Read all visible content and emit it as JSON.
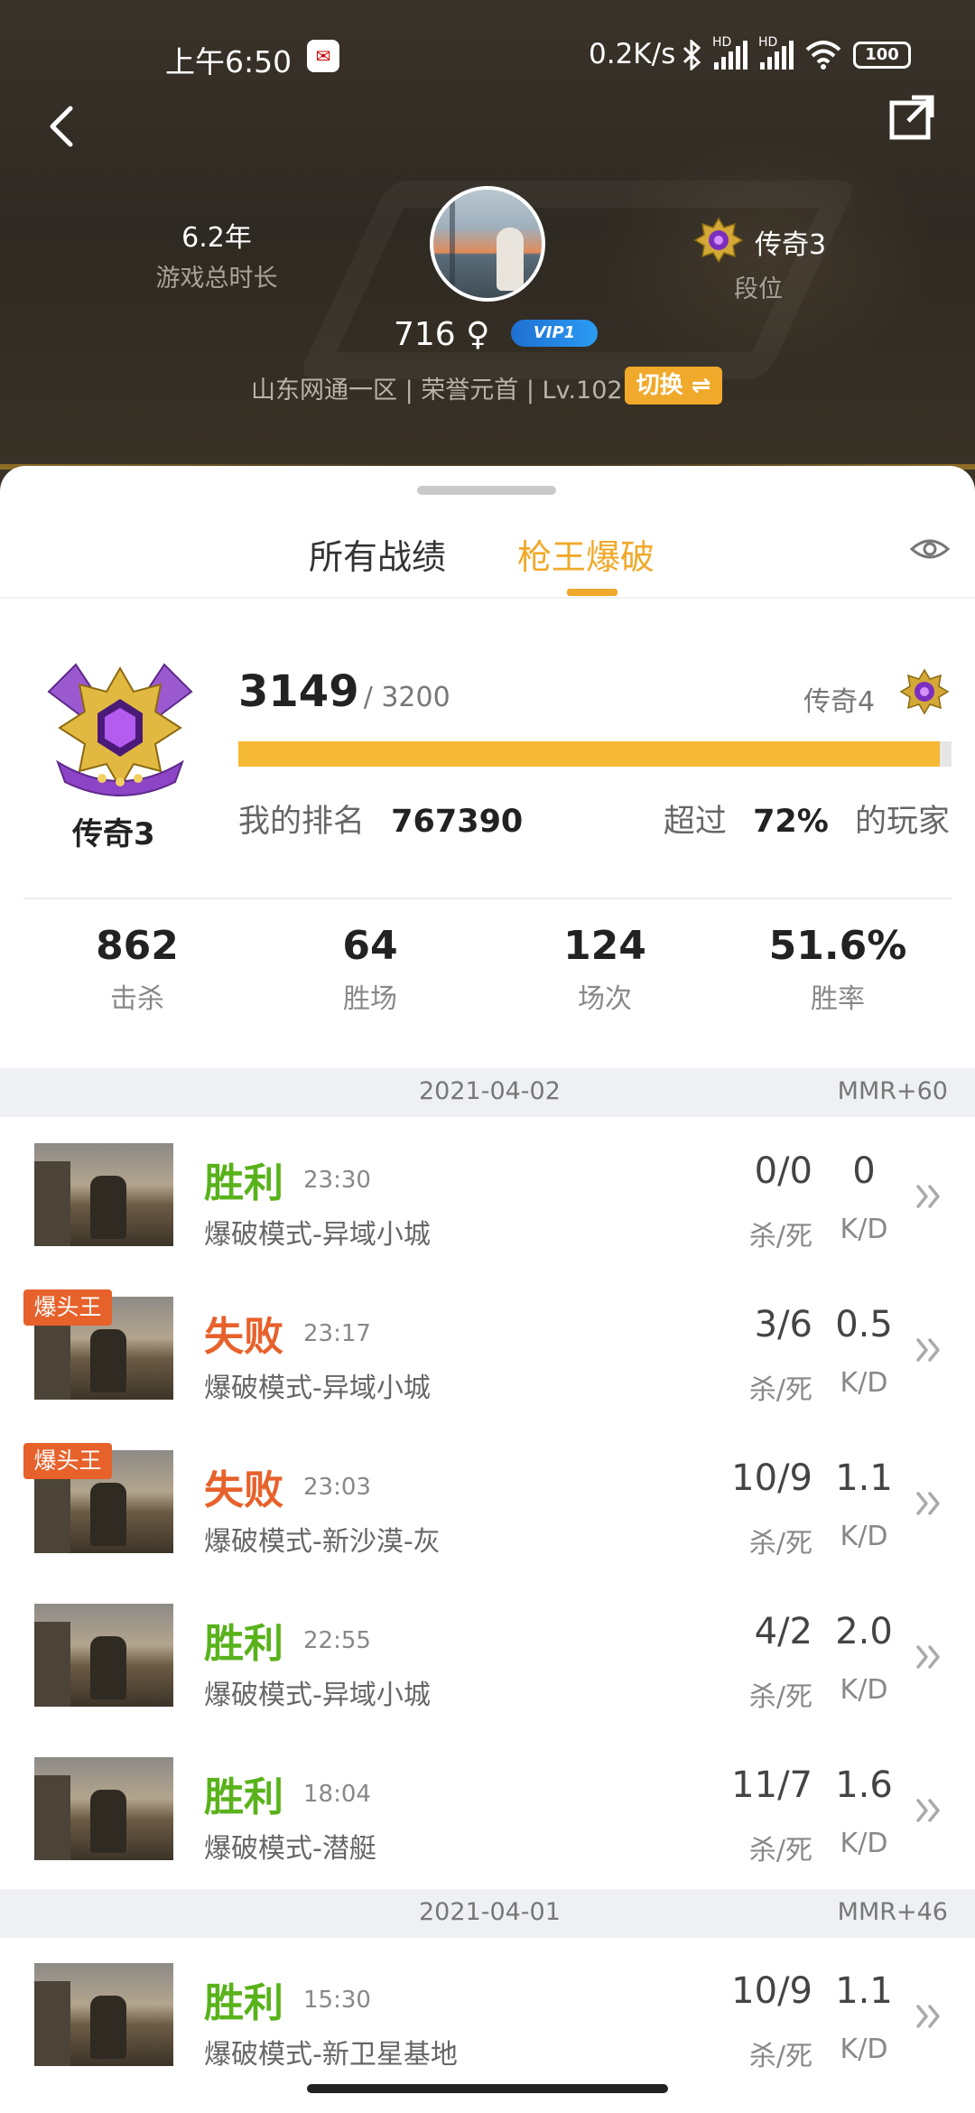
{
  "status_bar": {
    "time": "上午6:50",
    "speed": "0.2K/s",
    "battery": "100",
    "icons": [
      "bluetooth-icon",
      "signal-hd-icon",
      "signal-hd-icon",
      "wifi-icon",
      "battery-icon"
    ]
  },
  "header": {
    "play_years": "6.2年",
    "play_years_label": "游戏总时长",
    "rank_name": "传奇3",
    "rank_label": "段位",
    "user_id": "716",
    "gender_symbol": "♀",
    "vip": "VIP1",
    "server_info": "山东网通一区 | 荣誉元首 | Lv.102",
    "switch_label": "切换 ⇌"
  },
  "tabs": [
    {
      "label": "所有战绩",
      "active": false
    },
    {
      "label": "枪王爆破",
      "active": true
    }
  ],
  "rank_card": {
    "emblem_name": "传奇3",
    "score": "3149",
    "score_total": "/ 3200",
    "progress_fraction": 0.984,
    "next_rank": "传奇4",
    "my_rank_label": "我的排名",
    "my_rank_value": "767390",
    "exceed_prefix": "超过",
    "exceed_value": "72%",
    "exceed_suffix": "的玩家"
  },
  "stats": [
    {
      "value": "862",
      "label": "击杀"
    },
    {
      "value": "64",
      "label": "胜场"
    },
    {
      "value": "124",
      "label": "场次"
    },
    {
      "value": "51.6%",
      "label": "胜率"
    }
  ],
  "groups": [
    {
      "date": "2021-04-02",
      "mmr": "MMR+60",
      "matches": [
        {
          "result": "胜利",
          "win": true,
          "time": "23:30",
          "mode": "爆破模式-异域小城",
          "ks": "0/0",
          "ks_label": "杀/死",
          "kd": "0",
          "kd_label": "K/D",
          "badge": ""
        },
        {
          "result": "失败",
          "win": false,
          "time": "23:17",
          "mode": "爆破模式-异域小城",
          "ks": "3/6",
          "ks_label": "杀/死",
          "kd": "0.5",
          "kd_label": "K/D",
          "badge": "爆头王"
        },
        {
          "result": "失败",
          "win": false,
          "time": "23:03",
          "mode": "爆破模式-新沙漠-灰",
          "ks": "10/9",
          "ks_label": "杀/死",
          "kd": "1.1",
          "kd_label": "K/D",
          "badge": "爆头王"
        },
        {
          "result": "胜利",
          "win": true,
          "time": "22:55",
          "mode": "爆破模式-异域小城",
          "ks": "4/2",
          "ks_label": "杀/死",
          "kd": "2.0",
          "kd_label": "K/D",
          "badge": ""
        },
        {
          "result": "胜利",
          "win": true,
          "time": "18:04",
          "mode": "爆破模式-潜艇",
          "ks": "11/7",
          "ks_label": "杀/死",
          "kd": "1.6",
          "kd_label": "K/D",
          "badge": ""
        }
      ]
    },
    {
      "date": "2021-04-01",
      "mmr": "MMR+46",
      "matches": [
        {
          "result": "胜利",
          "win": true,
          "time": "15:30",
          "mode": "爆破模式-新卫星基地",
          "ks": "10/9",
          "ks_label": "杀/死",
          "kd": "1.1",
          "kd_label": "K/D",
          "badge": ""
        }
      ]
    }
  ],
  "colors": {
    "accent": "#f0a92a",
    "win": "#59b21b",
    "lose": "#e7612b",
    "progress": "#f5b936"
  }
}
